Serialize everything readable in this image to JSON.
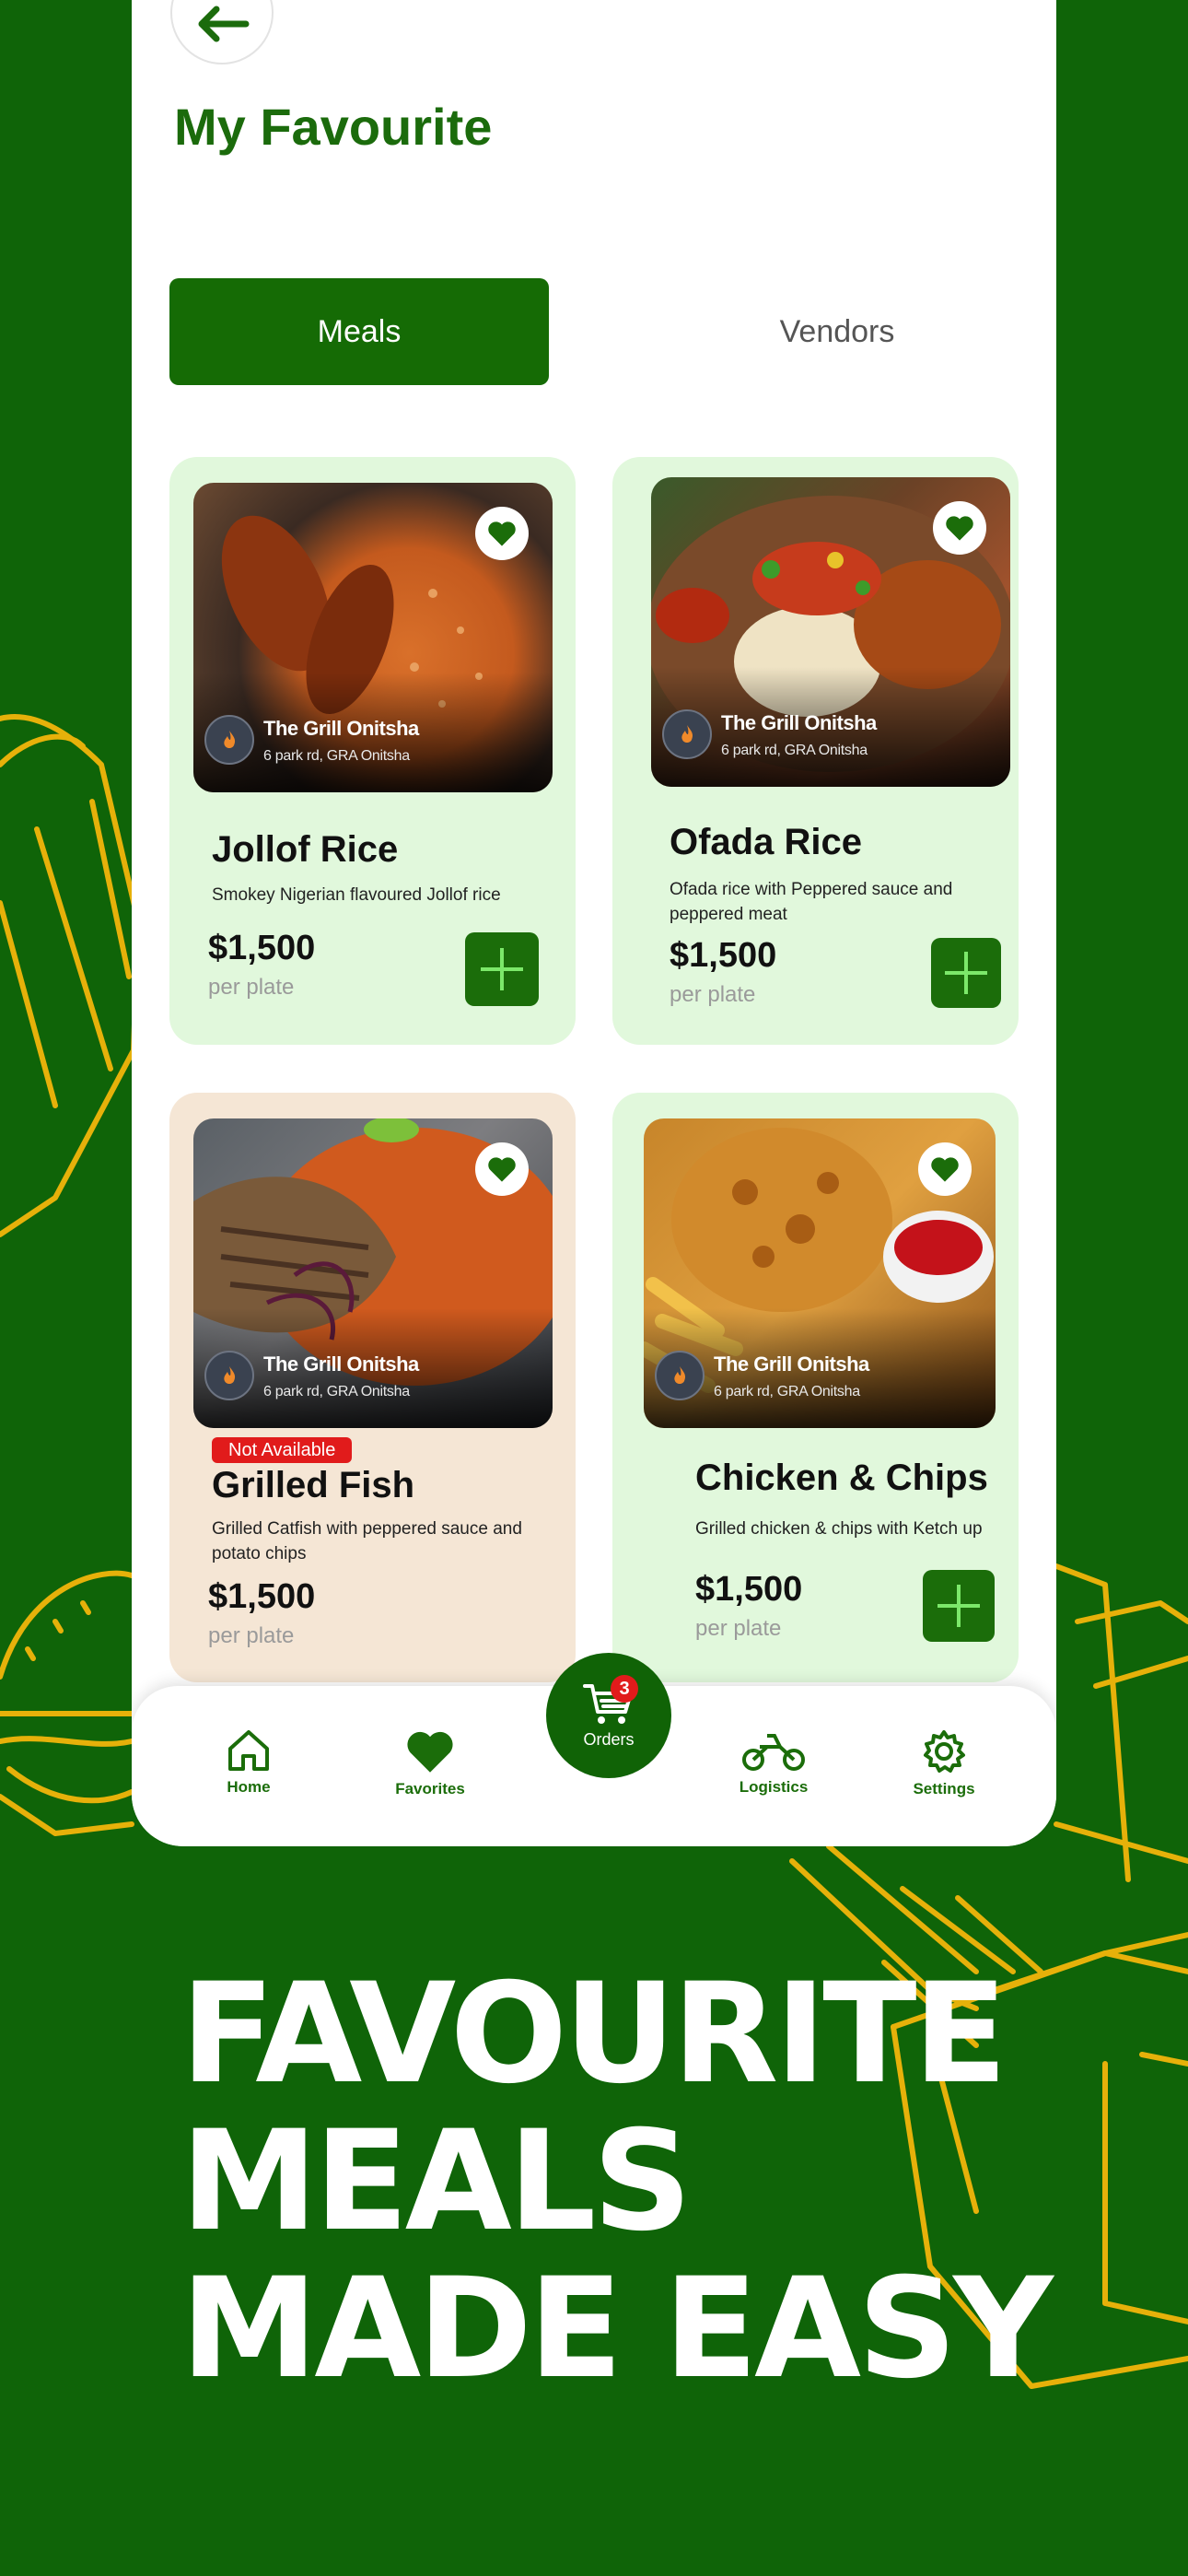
{
  "header": {
    "title": "My Favourite"
  },
  "tabs": [
    {
      "label": "Meals",
      "active": true
    },
    {
      "label": "Vendors",
      "active": false
    }
  ],
  "meals": [
    {
      "name": "Jollof Rice",
      "description": "Smokey Nigerian flavoured  Jollof rice",
      "price": "$1,500",
      "unit": "per plate",
      "vendor": "The Grill Onitsha",
      "address": "6 park rd, GRA Onitsha",
      "favorite": true,
      "available": true
    },
    {
      "name": "Ofada Rice",
      "description": "Ofada rice with Peppered sauce and peppered  meat",
      "price": "$1,500",
      "unit": "per plate",
      "vendor": "The Grill Onitsha",
      "address": "6 park rd, GRA Onitsha",
      "favorite": true,
      "available": true
    },
    {
      "name": "Grilled Fish",
      "description": "Grilled Catfish with peppered sauce and potato chips",
      "price": "$1,500",
      "unit": "per plate",
      "vendor": "The Grill Onitsha",
      "address": "6 park rd, GRA Onitsha",
      "favorite": true,
      "available": false,
      "badge": "Not Available"
    },
    {
      "name": "Chicken & Chips",
      "description": "Grilled chicken & chips with Ketch up",
      "price": "$1,500",
      "unit": "per plate",
      "vendor": "The Grill Onitsha",
      "address": "6 park rd, GRA Onitsha",
      "favorite": true,
      "available": true
    }
  ],
  "nav": {
    "home": "Home",
    "favorites": "Favorites",
    "orders": "Orders",
    "orders_count": "3",
    "logistics": "Logistics",
    "settings": "Settings"
  },
  "promo": {
    "line1": "FAVOURITE",
    "line2": "MEALS",
    "line3": "MADE EASY"
  },
  "colors": {
    "brand_green": "#156b05",
    "card_green": "#e1f8dc",
    "card_beige": "#f5e6d5",
    "doodle_yellow": "#e6b10a",
    "alert_red": "#e11b1b"
  }
}
